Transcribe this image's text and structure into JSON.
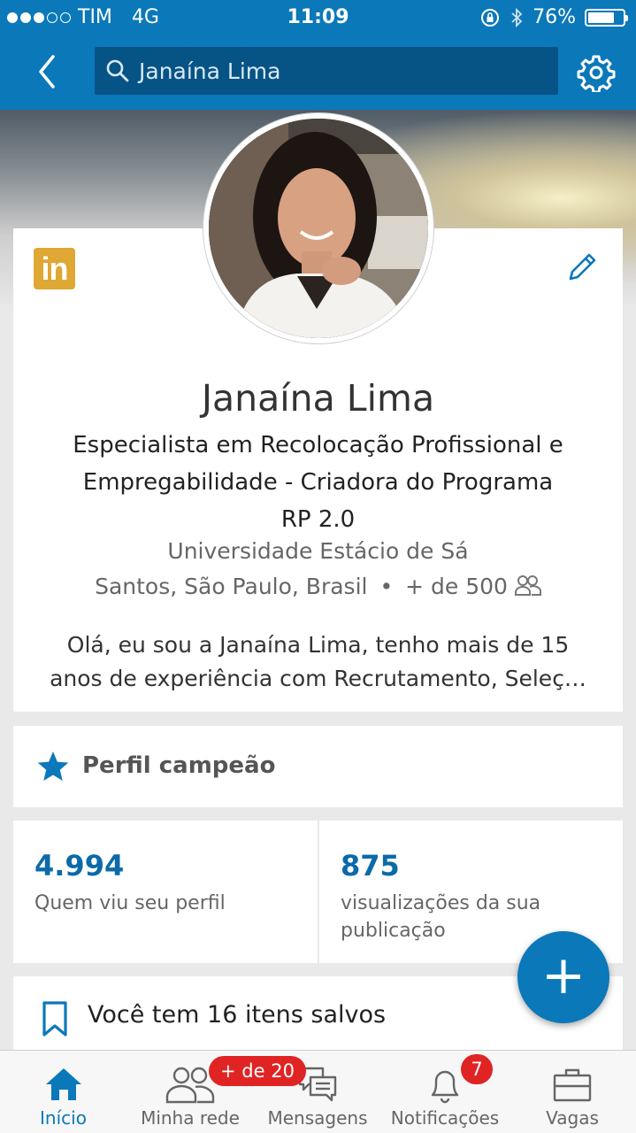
{
  "status_bar": {
    "carrier": "TIM",
    "network": "4G",
    "time": "11:09",
    "battery": "76%",
    "battery_level": 0.76
  },
  "nav": {
    "search_value": "Janaína Lima"
  },
  "profile": {
    "name": "Janaína Lima",
    "headline_line1": "Especialista em Recolocação Profissional e",
    "headline_line2": "Empregabilidade - Criadora do Programa",
    "headline_line3": "RP 2.0",
    "school": "Universidade Estácio de Sá",
    "location": "Santos, São Paulo, Brasil",
    "separator": "•",
    "connections": "+ de 500",
    "about_line1": "Olá, eu sou a Janaína Lima,  tenho mais de 15",
    "about_line2": "anos de experiência com Recrutamento, Seleç…",
    "logo_text": "in"
  },
  "badge_card": {
    "label": "Perfil campeão"
  },
  "stats": {
    "profile_views": "4.994",
    "profile_views_label": "Quem viu seu perfil",
    "post_views": "875",
    "post_views_label_line1": "visualizações da sua",
    "post_views_label_line2": "publicação"
  },
  "saved": {
    "label": "Você tem 16 itens salvos"
  },
  "fab": {
    "label": "+"
  },
  "tabs": [
    {
      "label": "Início",
      "icon": "home-icon"
    },
    {
      "label": "Minha rede",
      "icon": "network-icon",
      "badge": "+ de 20"
    },
    {
      "label": "Mensagens",
      "icon": "messages-icon"
    },
    {
      "label": "Notificações",
      "icon": "bell-icon",
      "badge": "7"
    },
    {
      "label": "Vagas",
      "icon": "briefcase-icon"
    }
  ],
  "colors": {
    "brand_blue": "#0b78b9",
    "badge_red": "#e02424",
    "linkedin_gold": "#dfa733"
  }
}
